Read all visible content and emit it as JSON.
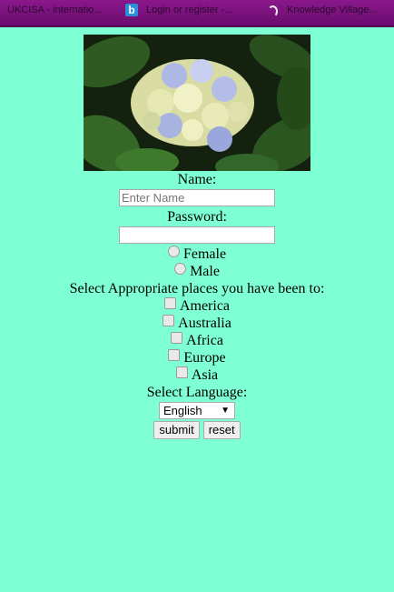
{
  "bookmarks": [
    {
      "label": "UKCISA - internatio...",
      "icon": "purple-favicon"
    },
    {
      "label": "Login or register -...",
      "icon": "b-icon"
    },
    {
      "label": "Knowledge Village...",
      "icon": "loading-icon"
    }
  ],
  "form": {
    "image_alt": "hydrangea-flower-photo",
    "name_label": "Name:",
    "name_placeholder": "Enter Name",
    "name_value": "",
    "password_label": "Password:",
    "password_value": "",
    "gender_options": [
      "Female",
      "Male"
    ],
    "places_label": "Select Appropriate places you have been to:",
    "places": [
      "America",
      "Australia",
      "Africa",
      "Europe",
      "Asia"
    ],
    "language_label": "Select Language:",
    "language_selected": "English",
    "submit_label": "submit",
    "reset_label": "reset"
  },
  "colors": {
    "background": "#7fffd4",
    "bookmark_bar": "#7a127c"
  }
}
